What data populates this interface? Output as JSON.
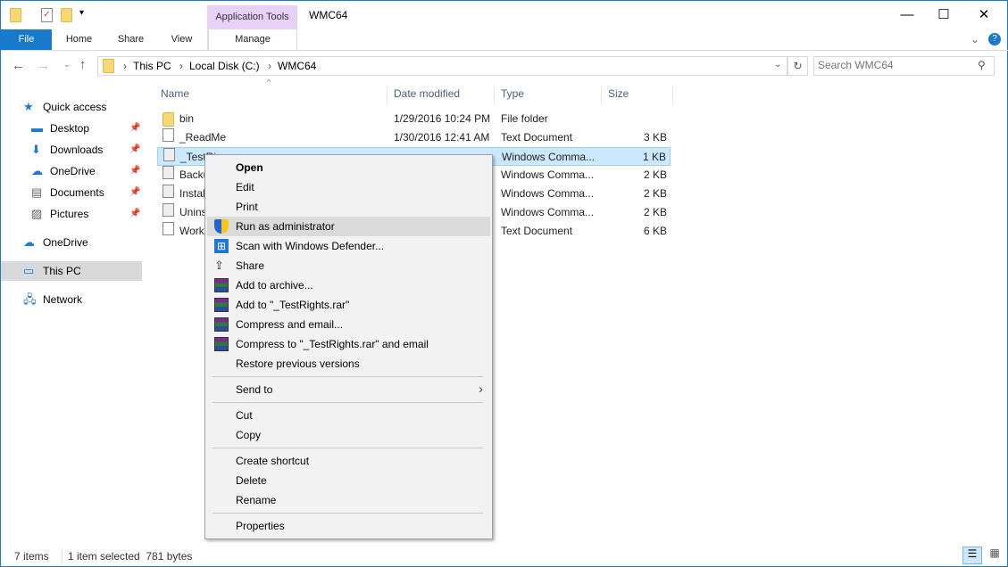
{
  "window": {
    "title": "WMC64",
    "context_tab": "Application Tools",
    "controls": {
      "minimize": "—",
      "maximize": "☐",
      "close": "✕"
    }
  },
  "ribbon": {
    "tabs": [
      "File",
      "Home",
      "Share",
      "View",
      "Manage"
    ],
    "collapse": "⌄",
    "help": "?"
  },
  "address": {
    "crumbs": [
      "This PC",
      "Local Disk (C:)",
      "WMC64"
    ],
    "search_placeholder": "Search WMC64"
  },
  "nav": [
    {
      "label": "Quick access",
      "icon": "star-icon",
      "pinned": false
    },
    {
      "label": "Desktop",
      "icon": "desktop-icon",
      "pinned": true
    },
    {
      "label": "Downloads",
      "icon": "download-icon",
      "pinned": true
    },
    {
      "label": "OneDrive",
      "icon": "cloud-icon",
      "pinned": true
    },
    {
      "label": "Documents",
      "icon": "documents-icon",
      "pinned": true
    },
    {
      "label": "Pictures",
      "icon": "pictures-icon",
      "pinned": true
    },
    {
      "label": "OneDrive",
      "icon": "cloud-icon",
      "pinned": false
    },
    {
      "label": "This PC",
      "icon": "computer-icon",
      "pinned": false,
      "selected": true
    },
    {
      "label": "Network",
      "icon": "network-icon",
      "pinned": false
    }
  ],
  "columns": [
    "Name",
    "Date modified",
    "Type",
    "Size"
  ],
  "files": [
    {
      "name": "bin",
      "date": "1/29/2016 10:24 PM",
      "type": "File folder",
      "size": "",
      "kind": "folder"
    },
    {
      "name": "_ReadMe",
      "date": "1/30/2016 12:41 AM",
      "type": "Text Document",
      "size": "3 KB",
      "kind": "text"
    },
    {
      "name": "_TestRi",
      "date": "",
      "type": "Windows Comma...",
      "size": "1 KB",
      "kind": "cmd",
      "selected": true
    },
    {
      "name": "Backu",
      "date": "",
      "type": "Windows Comma...",
      "size": "2 KB",
      "kind": "cmd"
    },
    {
      "name": "Instal",
      "date": "",
      "type": "Windows Comma...",
      "size": "2 KB",
      "kind": "cmd"
    },
    {
      "name": "Unins",
      "date": "",
      "type": "Windows Comma...",
      "size": "2 KB",
      "kind": "cmd"
    },
    {
      "name": "Work",
      "date": "",
      "type": "Text Document",
      "size": "6 KB",
      "kind": "text"
    }
  ],
  "context_menu": [
    {
      "label": "Open",
      "bold": true
    },
    {
      "label": "Edit"
    },
    {
      "label": "Print"
    },
    {
      "label": "Run as administrator",
      "icon": "shield-icon",
      "highlighted": true
    },
    {
      "label": "Scan with Windows Defender...",
      "icon": "defender-icon"
    },
    {
      "label": "Share",
      "icon": "share-icon"
    },
    {
      "label": "Add to archive...",
      "icon": "winrar-icon"
    },
    {
      "label": "Add to \"_TestRights.rar\"",
      "icon": "winrar-icon"
    },
    {
      "label": "Compress and email...",
      "icon": "winrar-icon"
    },
    {
      "label": "Compress to \"_TestRights.rar\" and email",
      "icon": "winrar-icon"
    },
    {
      "label": "Restore previous versions"
    },
    {
      "label": "Send to",
      "submenu": true
    },
    {
      "label": "Cut"
    },
    {
      "label": "Copy"
    },
    {
      "label": "Create shortcut"
    },
    {
      "label": "Delete"
    },
    {
      "label": "Rename"
    },
    {
      "label": "Properties"
    }
  ],
  "status": {
    "count": "7 items",
    "selection": "1 item selected  781 bytes"
  }
}
